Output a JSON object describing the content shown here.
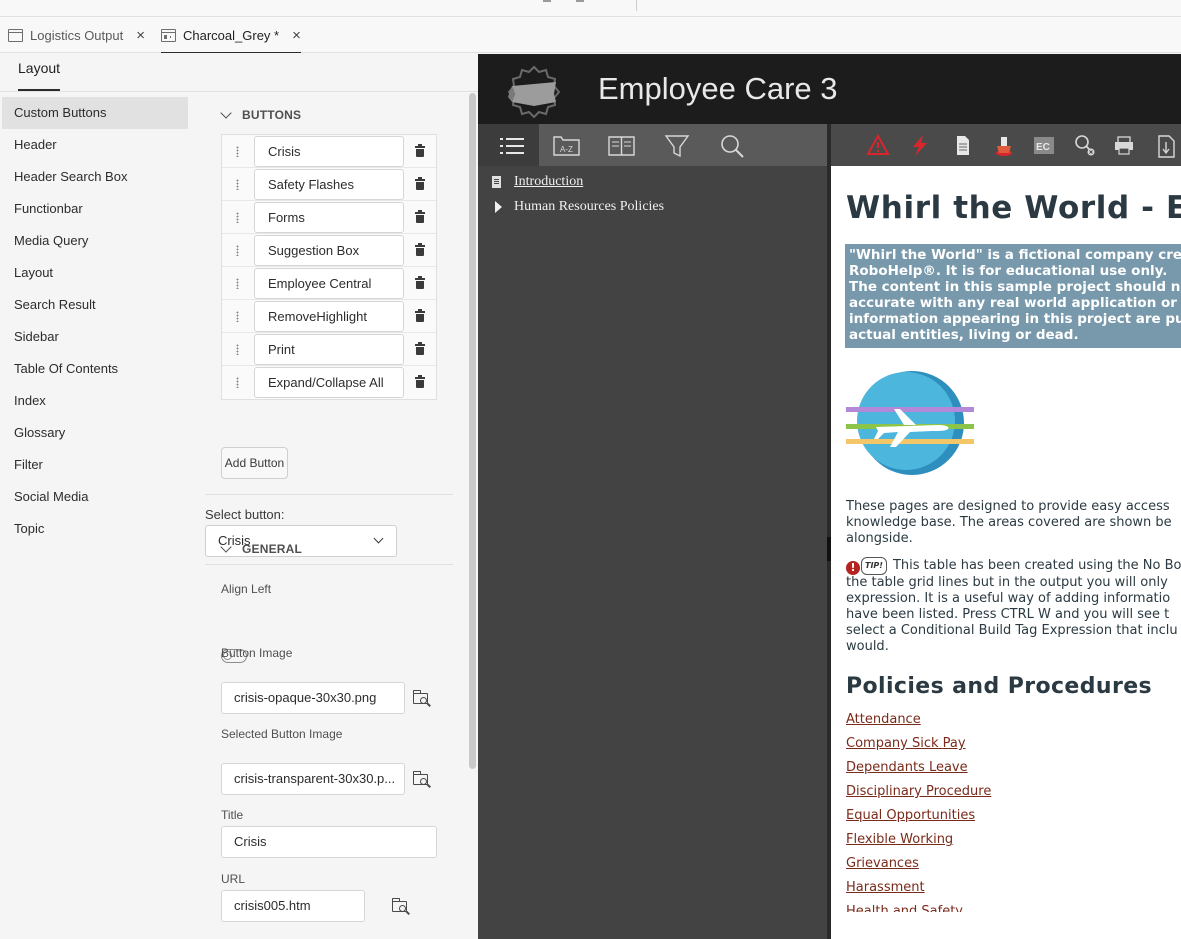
{
  "doc_tabs": [
    {
      "label": "Logistics Output",
      "close": "×"
    },
    {
      "label": "Charcoal_Grey *",
      "close": "×"
    }
  ],
  "panel_tab": "Layout",
  "nav_items": [
    "Custom Buttons",
    "Header",
    "Header Search Box",
    "Functionbar",
    "Media Query",
    "Layout",
    "Search Result",
    "Sidebar",
    "Table Of Contents",
    "Index",
    "Glossary",
    "Filter",
    "Social Media",
    "Topic"
  ],
  "buttons_section": {
    "heading": "BUTTONS",
    "items": [
      "Crisis",
      "Safety Flashes",
      "Forms",
      "Suggestion Box",
      "Employee Central",
      "RemoveHighlight",
      "Print",
      "Expand/Collapse All"
    ],
    "add_label": "Add Button"
  },
  "select_button": {
    "label": "Select button:",
    "value": "Crisis"
  },
  "general_section": {
    "heading": "GENERAL",
    "align_left_label": "Align Left",
    "align_left_on": false,
    "button_image_label": "Button Image",
    "button_image_value": "crisis-opaque-30x30.png",
    "selected_image_label": "Selected Button Image",
    "selected_image_value": "crisis-transparent-30x30.p...",
    "title_label": "Title",
    "title_value": "Crisis",
    "url_label": "URL",
    "url_value": "crisis005.htm"
  },
  "preview": {
    "site_title": "Employee Care 3",
    "toc": [
      {
        "label": "Introduction",
        "link": true
      },
      {
        "label": "Human Resources Policies",
        "link": false
      }
    ],
    "collapse_glyph": "«",
    "topic_heading": "Whirl the World - Em",
    "note_lines": [
      "\"Whirl the World\" is a fictional company crea",
      "RoboHelp®. It is for educational use only.",
      "The content in this sample project should no",
      "accurate with any real world application or s",
      "information appearing in this project are pur",
      "actual entities, living or dead."
    ],
    "intro_lines": [
      "These pages are designed to provide easy access",
      "knowledge base. The areas covered are shown be",
      "alongside."
    ],
    "tip_badge": "!",
    "tip_tag": "TIP!",
    "tip_lines": [
      "This table has been created using the No Bo",
      "the table grid lines but in the output you will only",
      "expression. It is a useful way of adding informatio",
      "have been listed. Press CTRL W and you will see t",
      "select a Conditional Build Tag Expression that inclu",
      "would."
    ],
    "policies_heading": "Policies and Procedures",
    "policy_links": [
      "Attendance",
      "Company Sick Pay",
      "Dependants Leave",
      "Disciplinary Procedure",
      "Equal Opportunities",
      "Flexible Working",
      "Grievances",
      "Harassment",
      "Health and Safety"
    ]
  },
  "colors": {
    "accent_selected_nav": "#e1e1e1",
    "preview_header": "#1c1c1c",
    "note_background": "#7799ab",
    "link_color": "#7a2a1a",
    "warning_red": "#d9262c"
  }
}
